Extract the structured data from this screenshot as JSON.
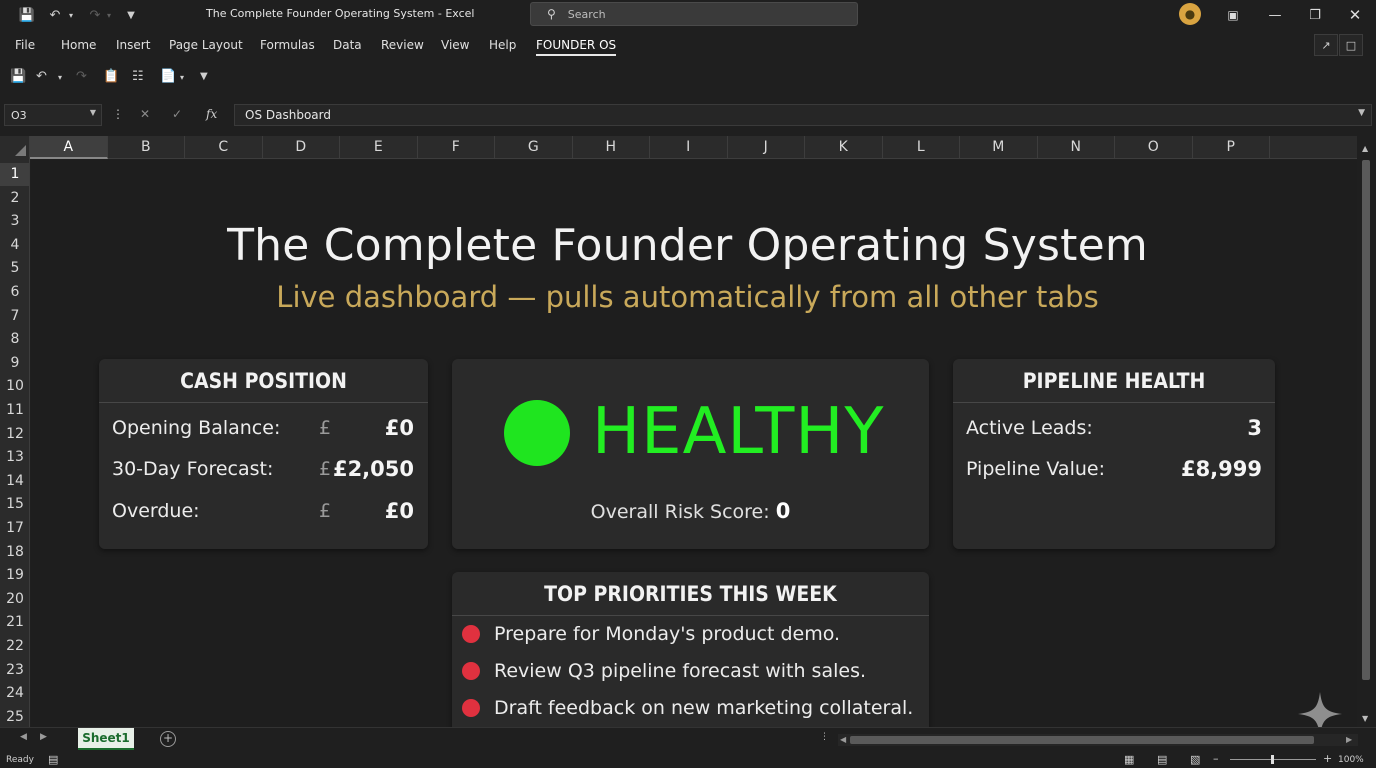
{
  "window": {
    "title": "The Complete Founder Operating System  -  Excel",
    "search_placeholder": "Search"
  },
  "menu": [
    "File",
    "Home",
    "Insert",
    "Page Layout",
    "Formulas",
    "Data",
    "Review",
    "View",
    "Help",
    "FOUNDER OS"
  ],
  "menu_active": "FOUNDER OS",
  "formula_bar": {
    "name_box": "O3",
    "fx": "fx",
    "content": "OS Dashboard"
  },
  "columns": [
    "A",
    "B",
    "C",
    "D",
    "E",
    "F",
    "G",
    "H",
    "I",
    "J",
    "K",
    "L",
    "M",
    "N",
    "O",
    "P"
  ],
  "rows": [
    "1",
    "2",
    "3",
    "4",
    "5",
    "6",
    "7",
    "8",
    "9",
    "10",
    "11",
    "12",
    "13",
    "14",
    "15",
    "17",
    "18",
    "19",
    "20",
    "21",
    "22",
    "23",
    "24",
    "25"
  ],
  "selected_column": "A",
  "selected_row": "1",
  "dashboard": {
    "title": "The Complete Founder Operating System",
    "subtitle": "Live dashboard — pulls automatically from all other tabs",
    "cash": {
      "header": "CASH POSITION",
      "rows": [
        {
          "label": "Opening Balance:",
          "currency": "£",
          "value": "£0"
        },
        {
          "label": "30-Day Forecast:",
          "currency": "£",
          "value": "£2,050"
        },
        {
          "label": "Overdue:",
          "currency": "£",
          "value": "£0"
        }
      ]
    },
    "status": {
      "label": "HEALTHY",
      "indicator_color": "#1fe51f",
      "risk_label": "Overall Risk Score:",
      "risk_value": "0"
    },
    "pipeline": {
      "header": "PIPELINE HEALTH",
      "rows": [
        {
          "label": "Active Leads:",
          "value": "3"
        },
        {
          "label": "Pipeline Value:",
          "value": "£8,999"
        }
      ]
    },
    "priorities": {
      "header": "TOP PRIORITIES THIS WEEK",
      "items": [
        "Prepare for Monday's product demo.",
        "Review Q3 pipeline forecast with sales.",
        "Draft feedback on new marketing collateral."
      ],
      "bullet_color": "#e0313f"
    }
  },
  "sheets": [
    "Sheet1"
  ],
  "status": {
    "ready": "Ready",
    "zoom": "100%"
  },
  "colors": {
    "title_text": "#f2f2f2",
    "subtitle_gold": "#c9a95a",
    "healthy_green": "#22ee22",
    "card_bg": "#2a2a2a"
  }
}
